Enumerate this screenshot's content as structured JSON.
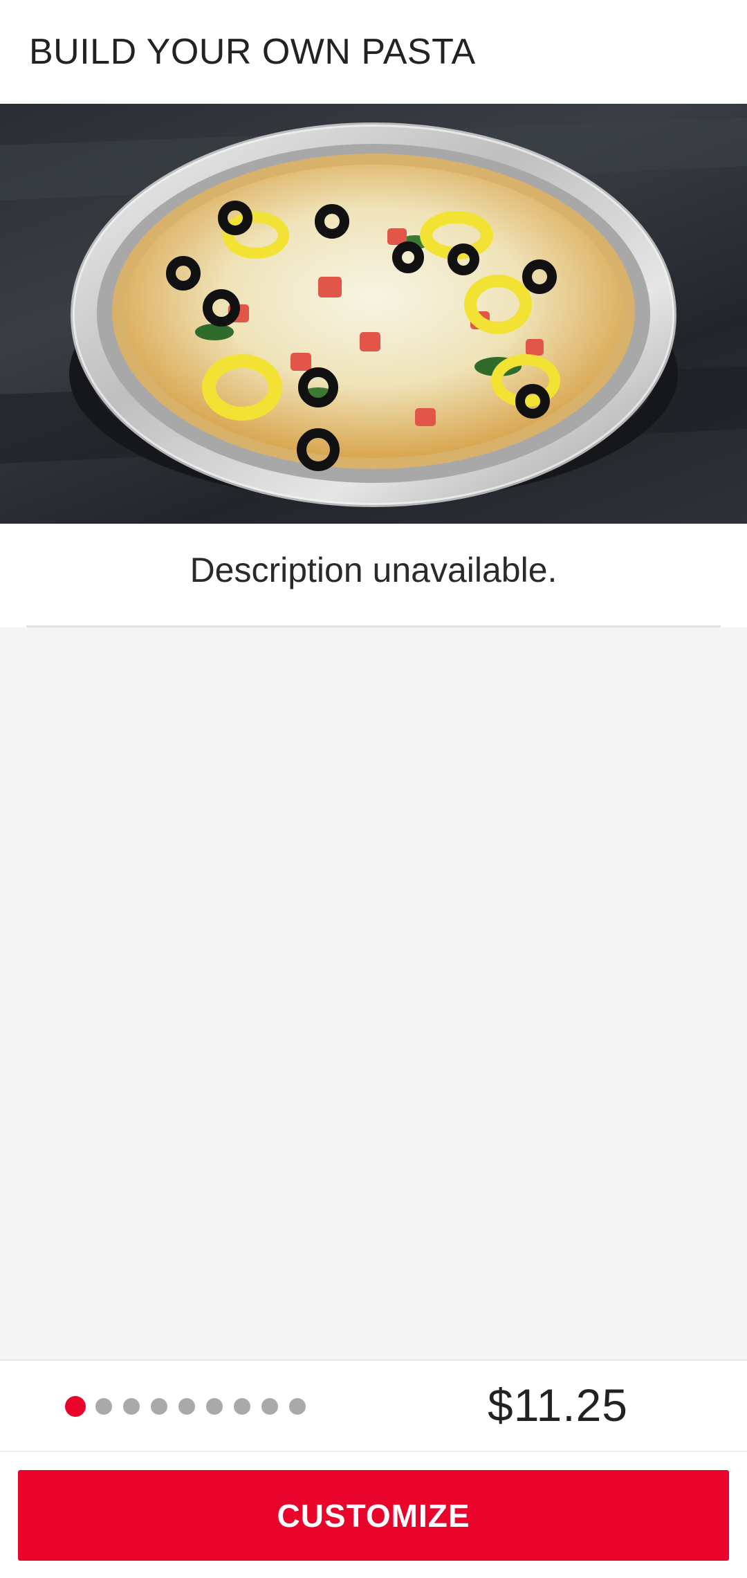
{
  "header": {
    "title": "BUILD YOUR OWN PASTA"
  },
  "hero": {
    "image_subject": "baked pasta in foil tray with olives, banana peppers, tomatoes and melted cheese"
  },
  "description": {
    "text": "Description unavailable."
  },
  "pager": {
    "total": 9,
    "active_index": 0
  },
  "price": {
    "value": "$11.25"
  },
  "actions": {
    "customize_label": "CUSTOMIZE"
  },
  "colors": {
    "accent": "#e8042b",
    "inactive_dot": "#a9a9a9",
    "content_bg": "#f4f4f4"
  }
}
